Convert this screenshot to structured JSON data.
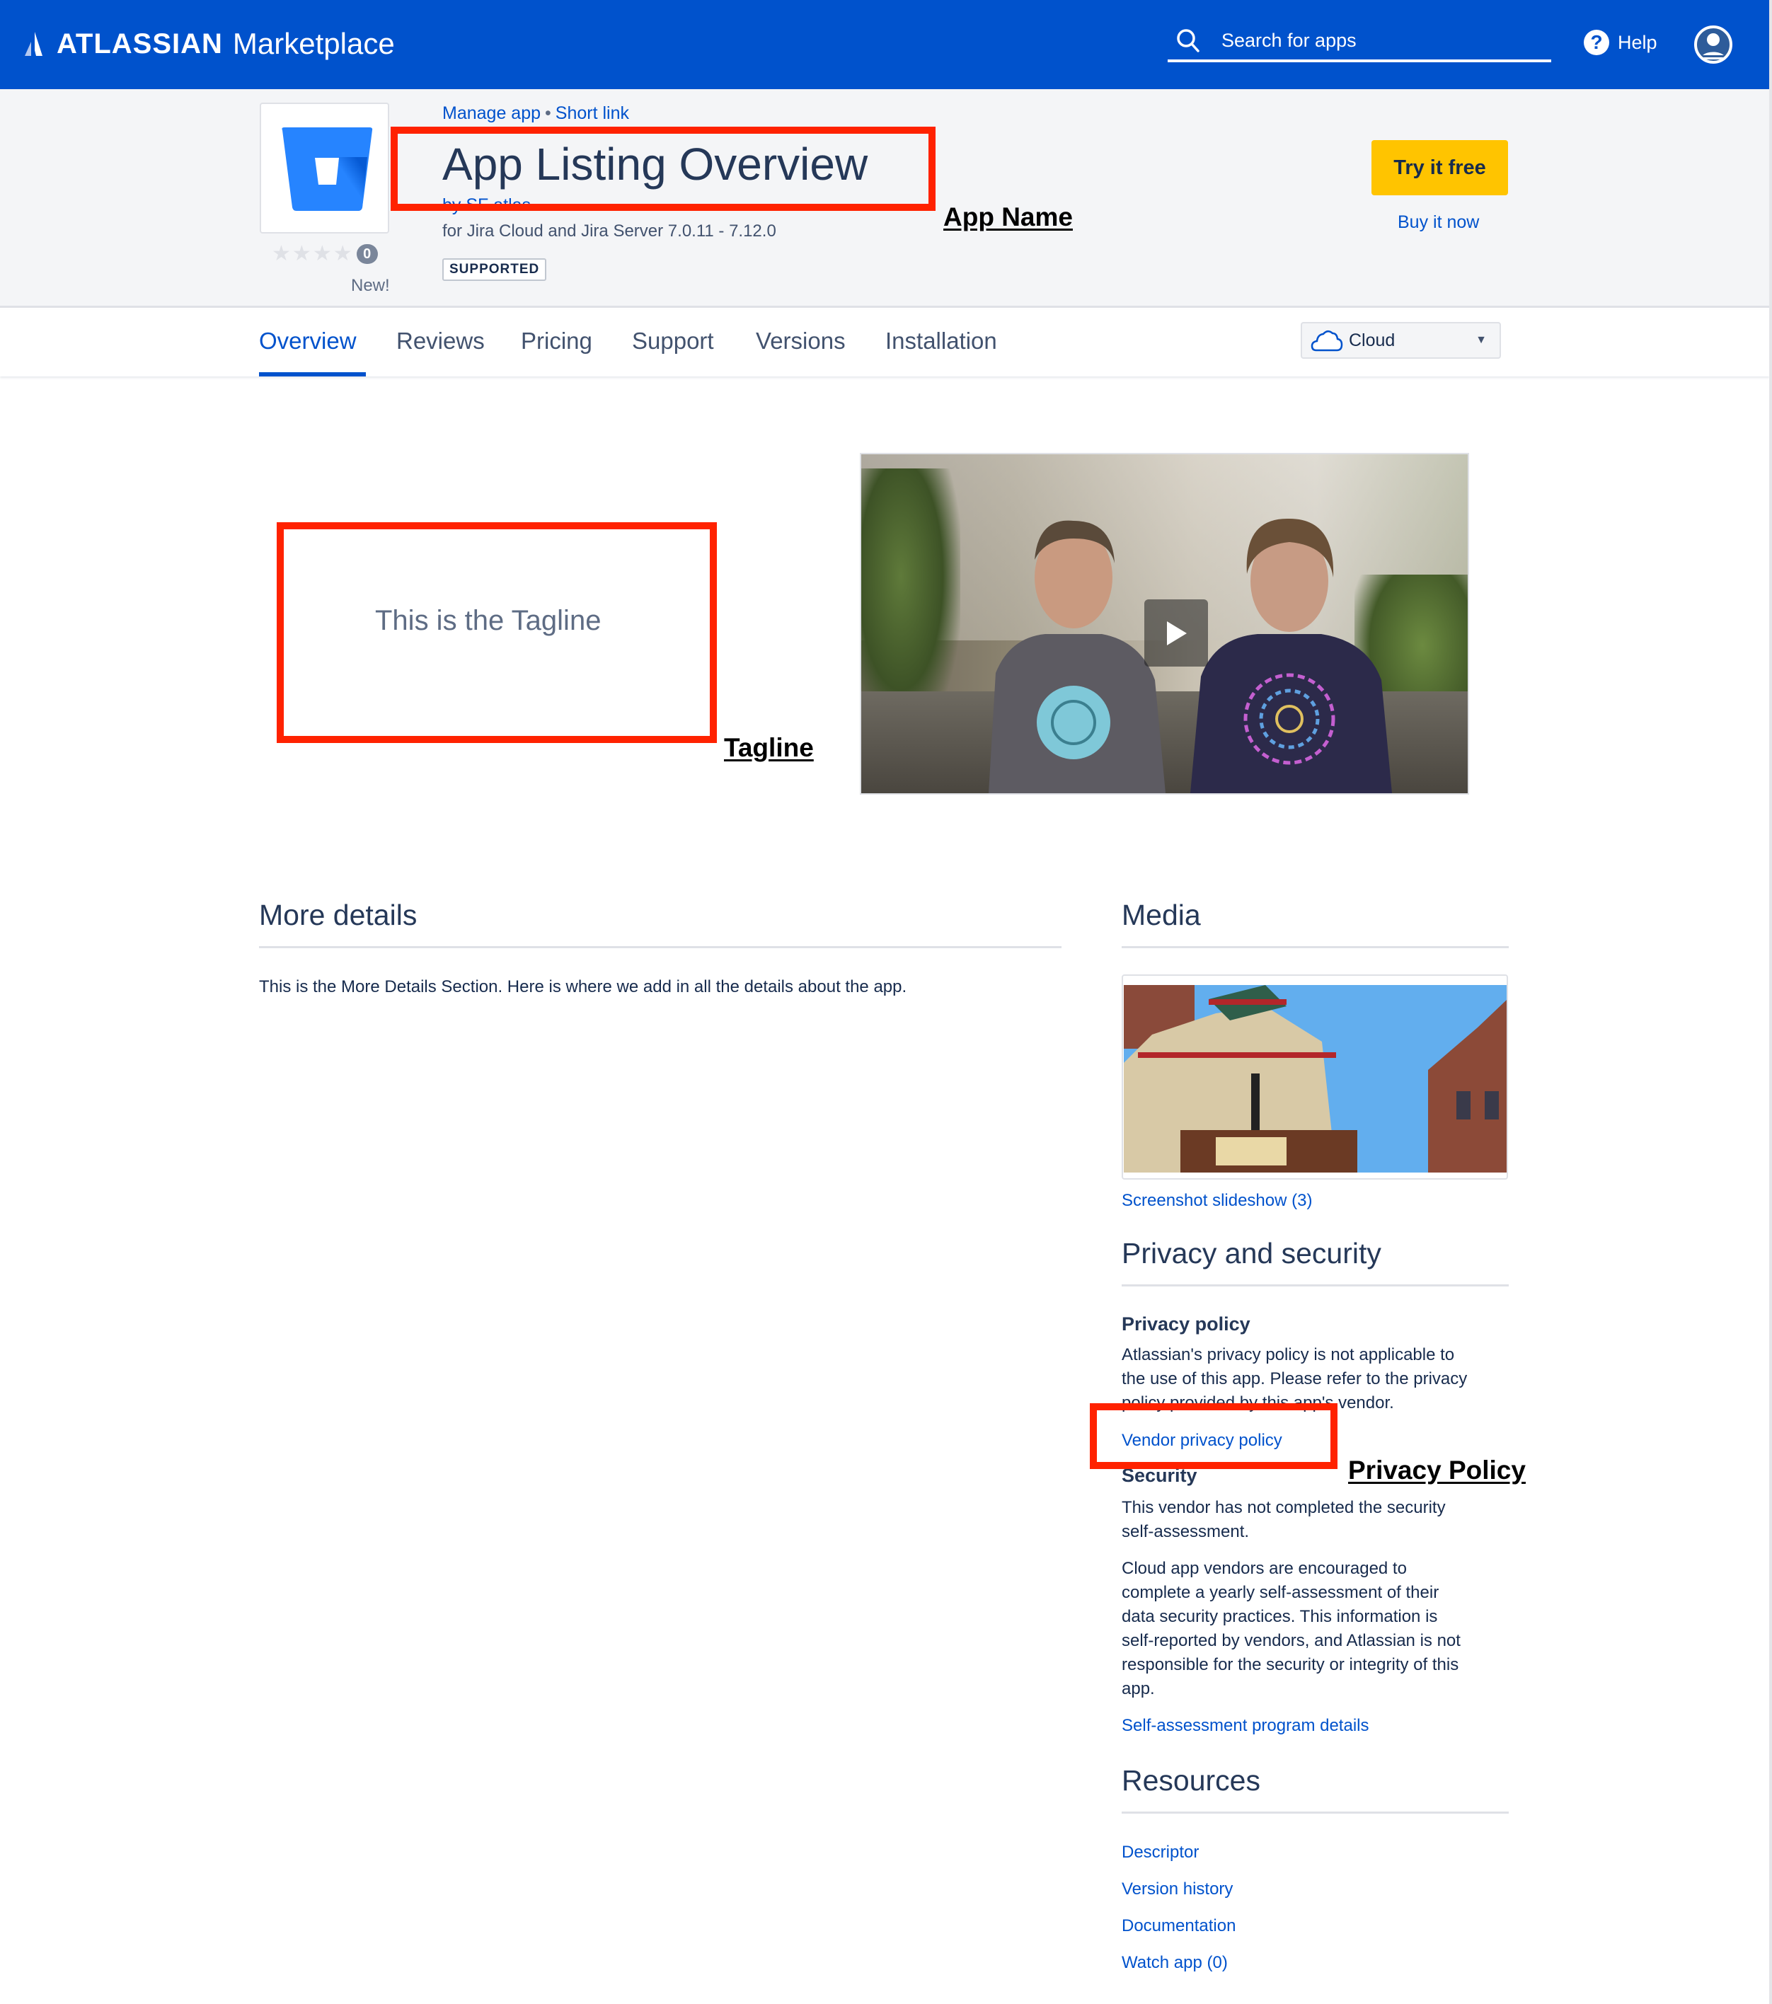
{
  "topbar": {
    "brand_word": "ATLASSIAN",
    "brand_sub": "Marketplace",
    "search_placeholder": "Search for apps",
    "help_label": "Help",
    "icons": {
      "search": "search-icon",
      "help": "help-circle-icon",
      "avatar": "user-avatar-icon",
      "logo": "atlassian-logo-icon"
    },
    "colors": {
      "bar": "#0052CC"
    }
  },
  "app_header": {
    "breadcrumbs": [
      {
        "label": "Manage app"
      },
      {
        "label": "Short link"
      }
    ],
    "breadcrumb_separator": "•",
    "title": "App Listing Overview",
    "vendor": "by SF atlas",
    "compatibility": "for Jira Cloud and Jira Server 7.0.11 - 7.12.0",
    "support_badge": "SUPPORTED",
    "rating": {
      "stars_max": 4,
      "stars_filled": 0,
      "review_count": "0",
      "status_label": "New!"
    },
    "try_button": "Try it free",
    "buy_link": "Buy it now",
    "colors": {
      "try_button": "#FFC400",
      "link": "#0052CC"
    }
  },
  "tabs": {
    "items": [
      {
        "label": "Overview",
        "active": true
      },
      {
        "label": "Reviews",
        "active": false
      },
      {
        "label": "Pricing",
        "active": false
      },
      {
        "label": "Support",
        "active": false
      },
      {
        "label": "Versions",
        "active": false
      },
      {
        "label": "Installation",
        "active": false
      }
    ],
    "hosting_select": {
      "value": "Cloud",
      "icon": "cloud-icon"
    }
  },
  "hero": {
    "tagline": "This is the Tagline",
    "video": {
      "play_icon": "play-icon"
    }
  },
  "more_details": {
    "heading": "More details",
    "body": "This is the More Details Section. Here is where we add in all the details about the app."
  },
  "media": {
    "heading": "Media",
    "slideshow_link": "Screenshot slideshow (3)"
  },
  "privacy_security": {
    "heading": "Privacy and security",
    "privacy_policy": {
      "heading": "Privacy policy",
      "lines": [
        "Atlassian's privacy policy is not applicable to",
        "the use of this app. Please refer to the privacy",
        "policy provided by this app's vendor."
      ],
      "link": "Vendor privacy policy"
    },
    "security": {
      "heading": "Security",
      "status_lines": [
        "This vendor has not completed the security",
        "self-assessment."
      ],
      "info_lines": [
        "Cloud app vendors are encouraged to",
        "complete a yearly self-assessment of their",
        "data security practices. This information is",
        "self-reported by vendors, and Atlassian is not",
        "responsible for the security or integrity of this",
        "app."
      ],
      "link": "Self-assessment program details"
    }
  },
  "resources": {
    "heading": "Resources",
    "links": [
      "Descriptor",
      "Version history",
      "Documentation",
      "Watch app (0)"
    ]
  },
  "annotations": {
    "app_name": "App Name",
    "tagline": "Tagline",
    "privacy_policy": "Privacy Policy",
    "color": "#FF2200"
  }
}
